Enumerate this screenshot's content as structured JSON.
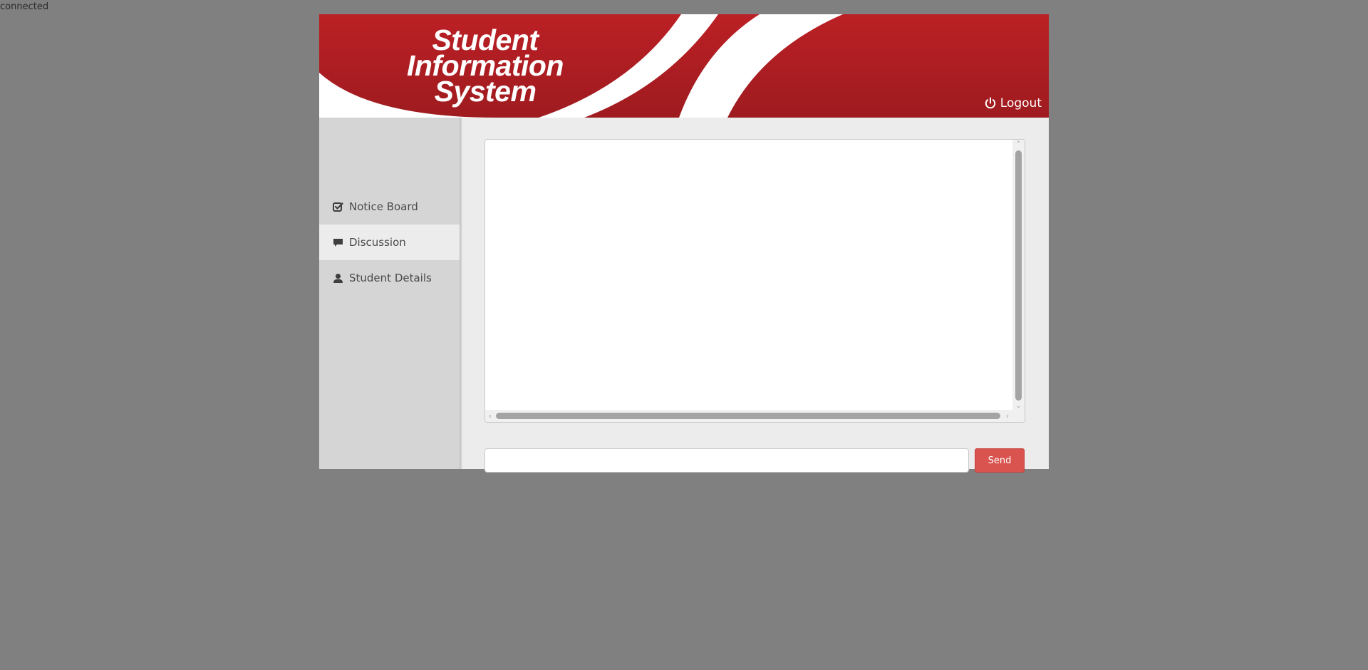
{
  "status": {
    "text": "connected"
  },
  "header": {
    "logo_lines": [
      "Student",
      "Information",
      "System"
    ],
    "logout_label": "Logout",
    "logout_icon": "power-icon",
    "colors": {
      "brand_red": "#b01e22",
      "banner_white": "#ffffff"
    }
  },
  "sidebar": {
    "items": [
      {
        "label": "Notice Board",
        "icon": "check-square-icon",
        "active": false
      },
      {
        "label": "Discussion",
        "icon": "comment-icon",
        "active": true
      },
      {
        "label": "Student Details",
        "icon": "user-icon",
        "active": false
      }
    ]
  },
  "chat": {
    "messages": [],
    "input_value": "",
    "input_placeholder": "",
    "send_label": "Send",
    "send_color": "#d9534f"
  }
}
